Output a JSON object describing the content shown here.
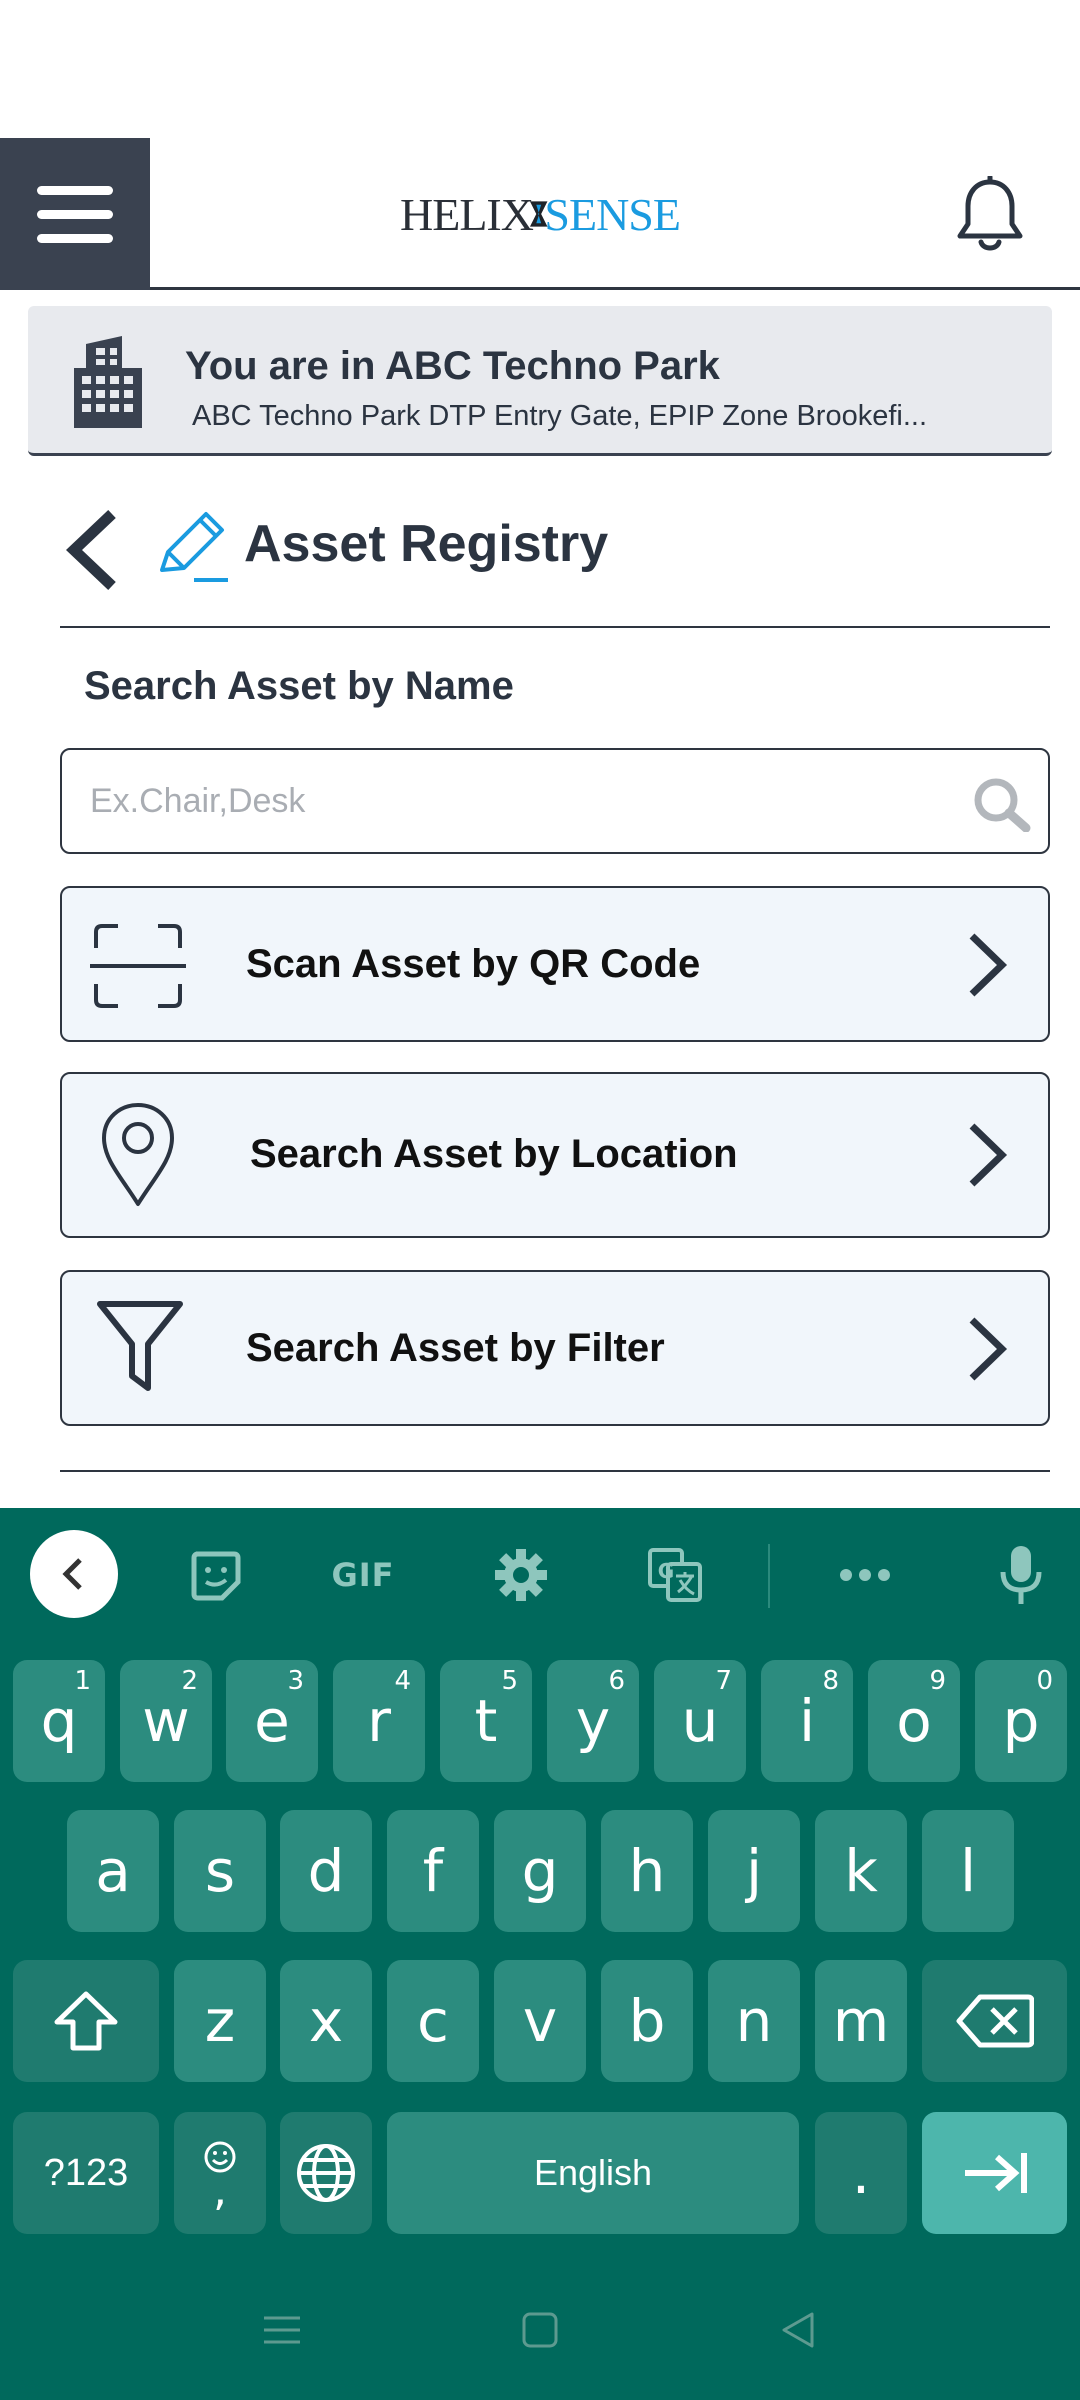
{
  "header": {
    "logo_left": "HELIX",
    "logo_right": "SENSE"
  },
  "location": {
    "title": "You are in ABC Techno Park",
    "subtitle": "ABC Techno Park DTP Entry Gate, EPIP Zone Brookefi..."
  },
  "page": {
    "title": "Asset Registry"
  },
  "search": {
    "label": "Search Asset by Name",
    "placeholder": "Ex.Chair,Desk",
    "value": ""
  },
  "options": [
    {
      "label": "Scan Asset by QR Code",
      "icon": "qr-scan-icon"
    },
    {
      "label": "Search Asset by Location",
      "icon": "location-pin-icon"
    },
    {
      "label": "Search Asset by Filter",
      "icon": "filter-icon"
    }
  ],
  "keyboard": {
    "toolbar": [
      "collapse-icon",
      "sticker-icon",
      "GIF",
      "gear-icon",
      "translate-icon",
      "more-icon",
      "mic-icon"
    ],
    "gif_label": "GIF",
    "row1": [
      {
        "key": "q",
        "hint": "1"
      },
      {
        "key": "w",
        "hint": "2"
      },
      {
        "key": "e",
        "hint": "3"
      },
      {
        "key": "r",
        "hint": "4"
      },
      {
        "key": "t",
        "hint": "5"
      },
      {
        "key": "y",
        "hint": "6"
      },
      {
        "key": "u",
        "hint": "7"
      },
      {
        "key": "i",
        "hint": "8"
      },
      {
        "key": "o",
        "hint": "9"
      },
      {
        "key": "p",
        "hint": "0"
      }
    ],
    "row2": [
      "a",
      "s",
      "d",
      "f",
      "g",
      "h",
      "j",
      "k",
      "l"
    ],
    "row3": [
      "z",
      "x",
      "c",
      "v",
      "b",
      "n",
      "m"
    ],
    "symbols_label": "?123",
    "comma_label": ",",
    "space_label": "English",
    "period_label": ".",
    "colors": {
      "background": "#00695c",
      "key": "#2c8c7f",
      "action": "#4db6ac"
    }
  },
  "nav": [
    "recents-icon",
    "home-icon",
    "back-icon"
  ]
}
